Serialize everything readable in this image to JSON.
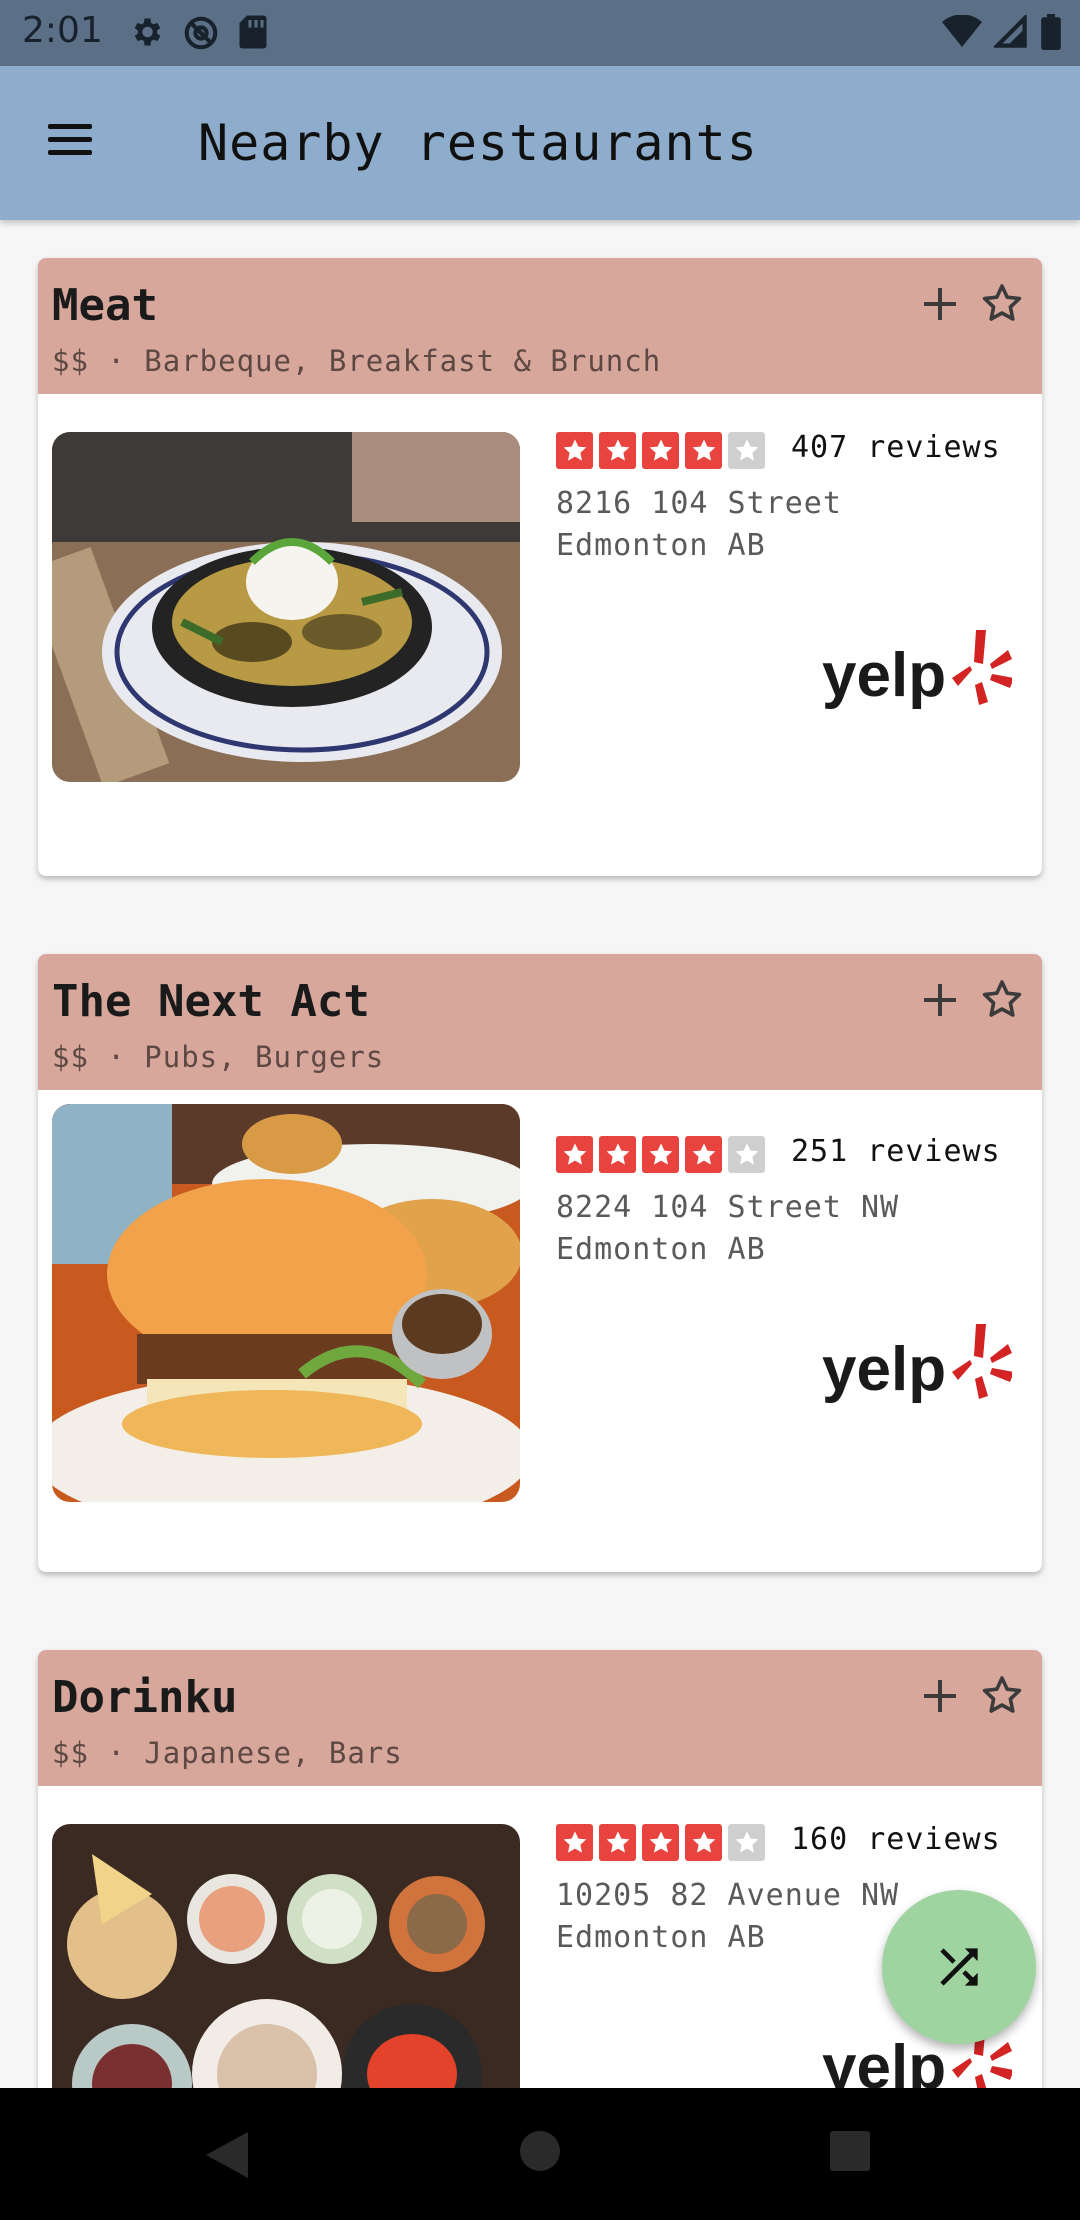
{
  "status": {
    "time": "2:01"
  },
  "appbar": {
    "title": "Nearby restaurants"
  },
  "restaurants": [
    {
      "name": "Meat",
      "subtitle": "$$ · Barbeque, Breakfast & Brunch",
      "rating": 4,
      "reviews": "407 reviews",
      "address_line1": "8216 104 Street",
      "address_line2": "Edmonton AB"
    },
    {
      "name": "The Next Act",
      "subtitle": "$$ · Pubs, Burgers",
      "rating": 4,
      "reviews": "251 reviews",
      "address_line1": "8224 104 Street NW",
      "address_line2": "Edmonton AB"
    },
    {
      "name": "Dorinku",
      "subtitle": "$$ · Japanese, Bars",
      "rating": 4,
      "reviews": "160 reviews",
      "address_line1": "10205 82 Avenue NW",
      "address_line2": "Edmonton AB"
    }
  ],
  "brand": {
    "yelp_label": "yelp",
    "yelp_color": "#d32323",
    "star_color": "#e8433e"
  },
  "colors": {
    "appbar": "#8eaccb",
    "statusbar": "#5b7087",
    "card_header": "#d7a79b",
    "fab": "#9fd4a0"
  },
  "icons": {
    "menu": "hamburger-icon",
    "add": "plus-icon",
    "favorite": "star-outline-icon",
    "fab": "shuffle-icon"
  }
}
